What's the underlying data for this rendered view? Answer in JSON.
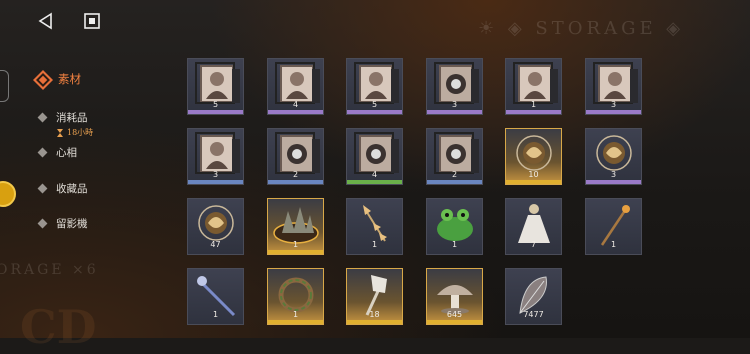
{
  "watermark": {
    "top": "☀ ◈ STORAGE ◈",
    "bottom": "ORAGE ×6",
    "big": "CD"
  },
  "menu": [
    {
      "label": "素材",
      "active": true
    },
    {
      "label": "消耗品",
      "timer": "18小時",
      "active": false
    },
    {
      "label": "心相",
      "active": false
    },
    {
      "label": "收藏品",
      "active": false
    },
    {
      "label": "留影機",
      "active": false
    }
  ],
  "colors": {
    "accent": "#e8703a",
    "purple": "#9a7ac8",
    "blue": "#6a86c0",
    "green": "#6ab04a",
    "yellow": "#e0b030"
  },
  "rows": [
    [
      {
        "name": "film-portrait-blonde",
        "icon": "film-portrait",
        "count": "5",
        "bar": "purple"
      },
      {
        "name": "film-portrait-hooded",
        "icon": "film-portrait",
        "count": "4",
        "bar": "purple"
      },
      {
        "name": "film-portrait-hat",
        "icon": "film-portrait",
        "count": "5",
        "bar": "purple"
      },
      {
        "name": "film-object-globe",
        "icon": "film-object",
        "count": "3",
        "bar": "purple"
      },
      {
        "name": "film-portrait-girl",
        "icon": "film-portrait",
        "count": "1",
        "bar": "purple"
      },
      {
        "name": "film-portrait-dark",
        "icon": "film-portrait",
        "count": "3",
        "bar": "purple"
      }
    ],
    [
      {
        "name": "film-portrait-cap",
        "icon": "film-portrait",
        "count": "3",
        "bar": "blue"
      },
      {
        "name": "film-object-car",
        "icon": "film-object",
        "count": "2",
        "bar": "blue"
      },
      {
        "name": "film-object-triangle",
        "icon": "film-object",
        "count": "4",
        "bar": "green"
      },
      {
        "name": "film-object-camera",
        "icon": "film-object",
        "count": "2",
        "bar": "blue"
      },
      {
        "name": "orb-gold-amulet",
        "icon": "orb",
        "count": "10",
        "bar": "yellow",
        "gold": true
      },
      {
        "name": "orb-silver-amulet",
        "icon": "orb",
        "count": "3",
        "bar": "purple"
      }
    ],
    [
      {
        "name": "orb-bird",
        "icon": "orb",
        "count": "47",
        "bar": "none"
      },
      {
        "name": "stone-gold",
        "icon": "stone",
        "count": "1",
        "bar": "yellow",
        "gold": true
      },
      {
        "name": "arrow-totem",
        "icon": "arrow-totem",
        "count": "1",
        "bar": "none"
      },
      {
        "name": "green-frog",
        "icon": "frog",
        "count": "1",
        "bar": "none"
      },
      {
        "name": "white-dress",
        "icon": "dress",
        "count": "7",
        "bar": "none"
      },
      {
        "name": "short-wand",
        "icon": "wand",
        "count": "1",
        "bar": "none"
      }
    ],
    [
      {
        "name": "blue-staff",
        "icon": "staff",
        "count": "1",
        "bar": "none"
      },
      {
        "name": "vine-wreath",
        "icon": "wreath",
        "count": "1",
        "bar": "yellow",
        "gold": true
      },
      {
        "name": "crystal-scepter",
        "icon": "scepter",
        "count": "18",
        "bar": "yellow",
        "gold": true
      },
      {
        "name": "mushroom",
        "icon": "mushroom",
        "count": "645",
        "bar": "yellow",
        "gold": true
      },
      {
        "name": "feather-mask",
        "icon": "feather",
        "count": "7477",
        "bar": "none"
      }
    ]
  ]
}
